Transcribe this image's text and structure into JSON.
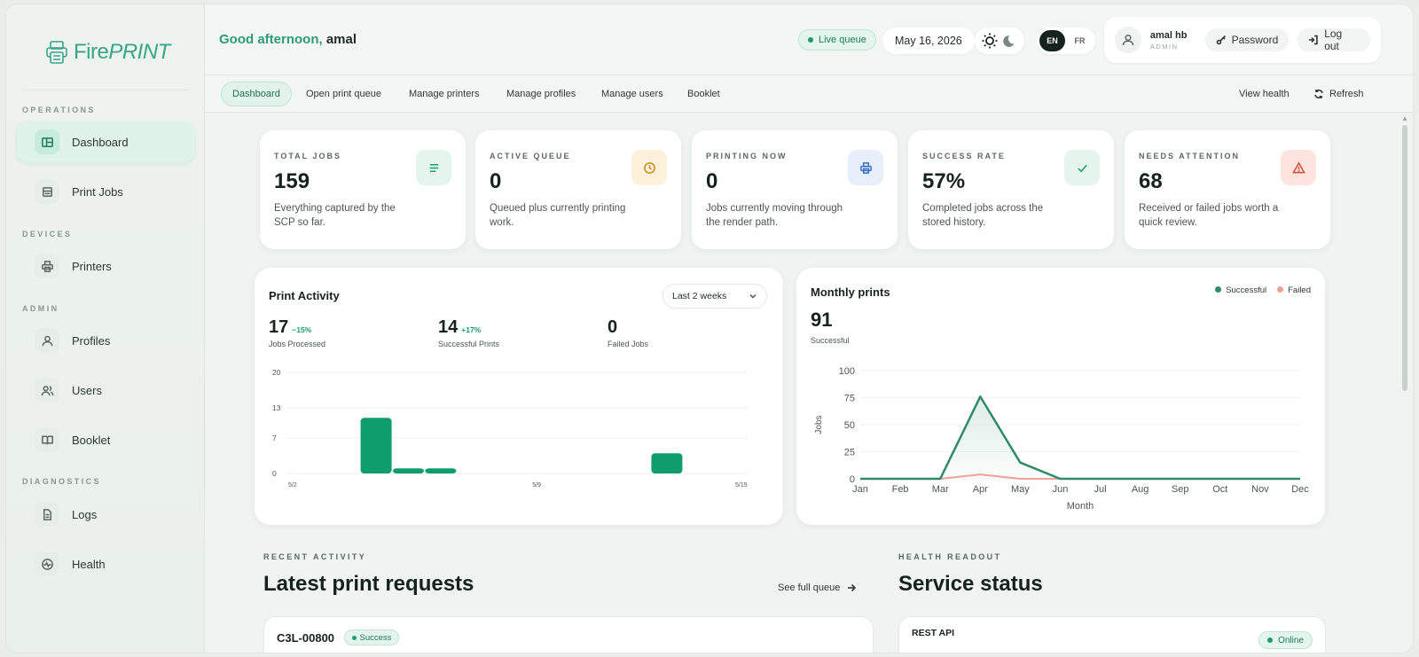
{
  "brand": {
    "prefix": "Fire",
    "suffix": "PRINT"
  },
  "sidebar": {
    "sections": [
      {
        "label": "OPERATIONS"
      },
      {
        "label": "DEVICES"
      },
      {
        "label": "ADMIN"
      },
      {
        "label": "DIAGNOSTICS"
      }
    ],
    "items": [
      {
        "label": "Dashboard",
        "icon": "dashboard-icon",
        "active": true
      },
      {
        "label": "Print Jobs",
        "icon": "print-jobs-icon"
      },
      {
        "label": "Printers",
        "icon": "printer-icon"
      },
      {
        "label": "Profiles",
        "icon": "user-icon"
      },
      {
        "label": "Users",
        "icon": "users-icon"
      },
      {
        "label": "Booklet",
        "icon": "book-icon"
      },
      {
        "label": "Logs",
        "icon": "file-icon"
      },
      {
        "label": "Health",
        "icon": "health-icon"
      }
    ]
  },
  "header": {
    "greeting": "Good afternoon,",
    "user_first": "amal",
    "live_label": "Live queue",
    "date": "May 16, 2026",
    "lang": [
      "EN",
      "FR"
    ],
    "user_name": "amal hb",
    "user_role": "ADMIN",
    "password_label": "Password",
    "logout_label": "Log out"
  },
  "tabs": {
    "items": [
      "Dashboard",
      "Open print queue",
      "Manage printers",
      "Manage profiles",
      "Manage users",
      "Booklet"
    ],
    "view_health": "View health",
    "refresh": "Refresh"
  },
  "stats": [
    {
      "label": "TOTAL JOBS",
      "value": "159",
      "desc": "Everything captured by the SCP so far.",
      "icon": "list-icon",
      "color": "#1e9a6e",
      "bg": "#e3f5ec"
    },
    {
      "label": "ACTIVE QUEUE",
      "value": "0",
      "desc": "Queued plus currently printing work.",
      "icon": "clock-icon",
      "color": "#c48a1a",
      "bg": "#fdf1dc"
    },
    {
      "label": "PRINTING NOW",
      "value": "0",
      "desc": "Jobs currently moving through the render path.",
      "icon": "printer-icon",
      "color": "#3a6fc4",
      "bg": "#e6effb"
    },
    {
      "label": "SUCCESS RATE",
      "value": "57%",
      "desc": "Completed jobs across the stored history.",
      "icon": "check-icon",
      "color": "#1e9a6e",
      "bg": "#e3f5ec"
    },
    {
      "label": "NEEDS ATTENTION",
      "value": "68",
      "desc": "Received or failed jobs worth a quick review.",
      "icon": "warning-icon",
      "color": "#d24b3a",
      "bg": "#fde4df"
    }
  ],
  "activity": {
    "title": "Print Activity",
    "range": "Last 2 weeks",
    "metrics": [
      {
        "value": "17",
        "delta": "−15%",
        "label": "Jobs Processed"
      },
      {
        "value": "14",
        "delta": "+17%",
        "label": "Successful Prints"
      },
      {
        "value": "0",
        "delta": "",
        "label": "Failed Jobs"
      }
    ]
  },
  "monthly": {
    "title": "Monthly prints",
    "total": "91",
    "total_label": "Successful",
    "legend": [
      "Successful",
      "Failed"
    ]
  },
  "recent": {
    "kicker": "RECENT ACTIVITY",
    "title": "Latest print requests",
    "see_full": "See full queue",
    "first_id": "C3L-00800",
    "first_status": "Success"
  },
  "health": {
    "kicker": "HEALTH READOUT",
    "title": "Service status",
    "first_service": "REST API",
    "first_status": "Online"
  },
  "colors": {
    "accent": "#1e9a6e",
    "failed": "#f0a09a"
  },
  "chart_data": [
    {
      "type": "bar",
      "title": "Print Activity",
      "categories": [
        "5/2",
        "5/3",
        "5/4",
        "5/5",
        "5/6",
        "5/7",
        "5/8",
        "5/9",
        "5/10",
        "5/11",
        "5/12",
        "5/13",
        "5/14",
        "5/15"
      ],
      "x_tick_labels": [
        "5/2",
        "5/9",
        "5/15"
      ],
      "y_tick_labels": [
        "0",
        "7",
        "13",
        "20"
      ],
      "ylim": [
        0,
        20
      ],
      "series": [
        {
          "values": [
            0,
            0,
            11,
            1,
            1,
            0,
            0,
            0,
            0,
            0,
            0,
            4,
            0,
            0
          ]
        }
      ],
      "grid": true
    },
    {
      "type": "line",
      "title": "Monthly prints",
      "xlabel": "Month",
      "ylabel": "Jobs",
      "categories": [
        "Jan",
        "Feb",
        "Mar",
        "Apr",
        "May",
        "Jun",
        "Jul",
        "Aug",
        "Sep",
        "Oct",
        "Nov",
        "Dec"
      ],
      "y_tick_labels": [
        "0",
        "25",
        "50",
        "75",
        "100"
      ],
      "ylim": [
        0,
        100
      ],
      "series": [
        {
          "name": "Successful",
          "values": [
            0,
            0,
            0,
            76,
            15,
            0,
            0,
            0,
            0,
            0,
            0,
            0
          ]
        },
        {
          "name": "Failed",
          "values": [
            0,
            0,
            0,
            4,
            0,
            0,
            0,
            0,
            0,
            0,
            0,
            0
          ]
        }
      ],
      "legend": "top-right",
      "grid": true
    }
  ]
}
